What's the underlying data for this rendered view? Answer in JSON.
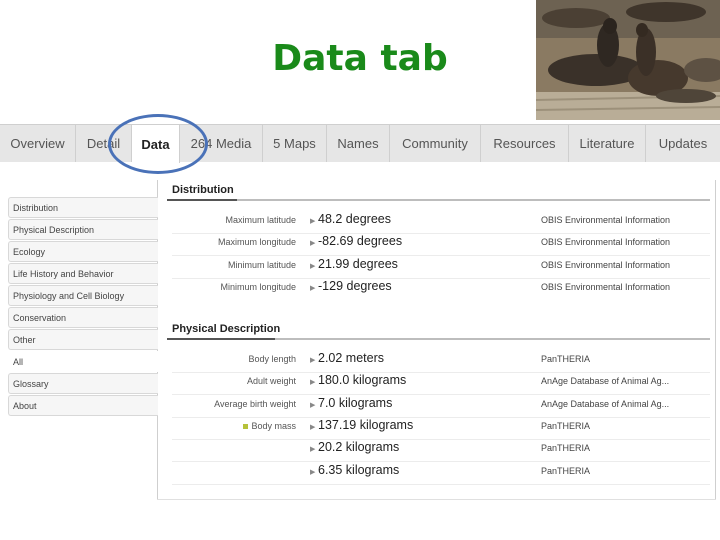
{
  "slide_title": "Data tab",
  "tabs": [
    {
      "label": "Overview",
      "active": false
    },
    {
      "label": "Detail",
      "active": false
    },
    {
      "label": "Data",
      "active": true
    },
    {
      "label": "264 Media",
      "active": false
    },
    {
      "label": "5 Maps",
      "active": false
    },
    {
      "label": "Names",
      "active": false
    },
    {
      "label": "Community",
      "active": false
    },
    {
      "label": "Resources",
      "active": false
    },
    {
      "label": "Literature",
      "active": false
    },
    {
      "label": "Updates",
      "active": false
    }
  ],
  "sidebar": {
    "items": [
      {
        "label": "Distribution"
      },
      {
        "label": "Physical Description"
      },
      {
        "label": "Ecology"
      },
      {
        "label": "Life History and Behavior"
      },
      {
        "label": "Physiology and Cell Biology"
      },
      {
        "label": "Conservation"
      },
      {
        "label": "Other"
      },
      {
        "label": "All"
      },
      {
        "label": "Glossary"
      },
      {
        "label": "About"
      }
    ]
  },
  "sections": [
    {
      "title": "Distribution",
      "rows": [
        {
          "label": "Maximum latitude",
          "value": "48.2 degrees",
          "source": "OBIS Environmental Information"
        },
        {
          "label": "Maximum longitude",
          "value": "-82.69 degrees",
          "source": "OBIS Environmental Information"
        },
        {
          "label": "Minimum latitude",
          "value": "21.99 degrees",
          "source": "OBIS Environmental Information"
        },
        {
          "label": "Minimum longitude",
          "value": "-129 degrees",
          "source": "OBIS Environmental Information"
        }
      ]
    },
    {
      "title": "Physical Description",
      "rows": [
        {
          "label": "Body length",
          "value": "2.02 meters",
          "source": "PanTHERIA"
        },
        {
          "label": "Adult weight",
          "value": "180.0 kilograms",
          "source": "AnAge Database of Animal Ag..."
        },
        {
          "label": "Average birth weight",
          "value": "7.0 kilograms",
          "source": "AnAge Database of Animal Ag..."
        },
        {
          "label": "Body mass",
          "value": "137.19 kilograms",
          "source": "PanTHERIA"
        },
        {
          "label": "",
          "value": "20.2 kilograms",
          "source": "PanTHERIA"
        },
        {
          "label": "",
          "value": "6.35 kilograms",
          "source": "PanTHERIA"
        }
      ]
    }
  ],
  "colors": {
    "title_green": "#1a8a1a",
    "circle_blue": "#4a72b8"
  },
  "icons": {
    "row_expand": "triangle-right-icon",
    "body_mass_marker": "square-marker-icon"
  }
}
